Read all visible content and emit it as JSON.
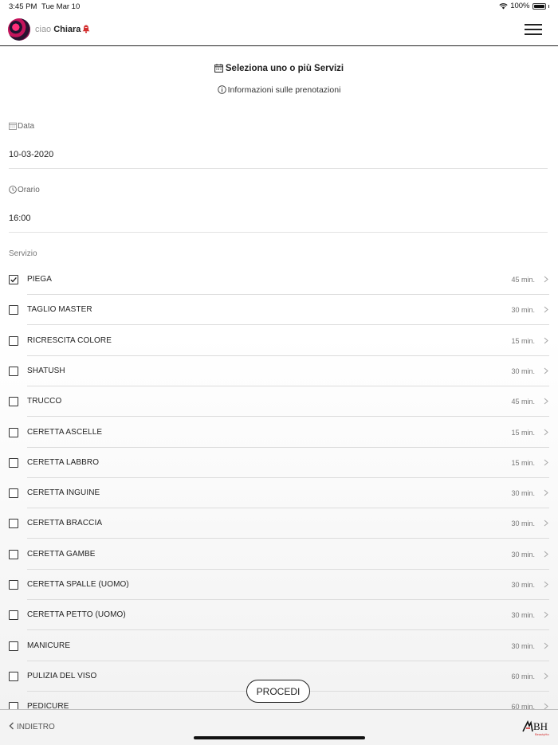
{
  "status_bar": {
    "time": "3:45 PM",
    "date": "Tue Mar 10",
    "battery": "100%"
  },
  "header": {
    "greeting": "ciao",
    "user_name": "Chiara"
  },
  "page": {
    "title": "Seleziona uno o più Servizi",
    "info_link": "Informazioni sulle prenotazioni"
  },
  "form": {
    "date_label": "Data",
    "date_value": "10-03-2020",
    "time_label": "Orario",
    "time_value": "16:00",
    "service_label": "Servizio"
  },
  "services": [
    {
      "name": "PIEGA",
      "duration": "45 min.",
      "checked": true
    },
    {
      "name": "TAGLIO MASTER",
      "duration": "30 min.",
      "checked": false
    },
    {
      "name": "RICRESCITA COLORE",
      "duration": "15 min.",
      "checked": false
    },
    {
      "name": "SHATUSH",
      "duration": "30 min.",
      "checked": false
    },
    {
      "name": "TRUCCO",
      "duration": "45 min.",
      "checked": false
    },
    {
      "name": "CERETTA ASCELLE",
      "duration": "15 min.",
      "checked": false
    },
    {
      "name": "CERETTA LABBRO",
      "duration": "15 min.",
      "checked": false
    },
    {
      "name": "CERETTA INGUINE",
      "duration": "30 min.",
      "checked": false
    },
    {
      "name": "CERETTA BRACCIA",
      "duration": "30 min.",
      "checked": false
    },
    {
      "name": "CERETTA GAMBE",
      "duration": "30 min.",
      "checked": false
    },
    {
      "name": "CERETTA SPALLE (UOMO)",
      "duration": "30 min.",
      "checked": false
    },
    {
      "name": "CERETTA PETTO (UOMO)",
      "duration": "30 min.",
      "checked": false
    },
    {
      "name": "MANICURE",
      "duration": "30 min.",
      "checked": false
    },
    {
      "name": "PULIZIA DEL VISO",
      "duration": "60 min.",
      "checked": false
    },
    {
      "name": "PEDICURE",
      "duration": "60 min.",
      "checked": false
    }
  ],
  "actions": {
    "proceed": "PROCEDI",
    "back": "INDIETRO"
  },
  "brand": {
    "logo_text": "BeautyHouse"
  },
  "colors": {
    "accent": "#d32f2f",
    "text": "#222222",
    "muted": "#777777"
  }
}
